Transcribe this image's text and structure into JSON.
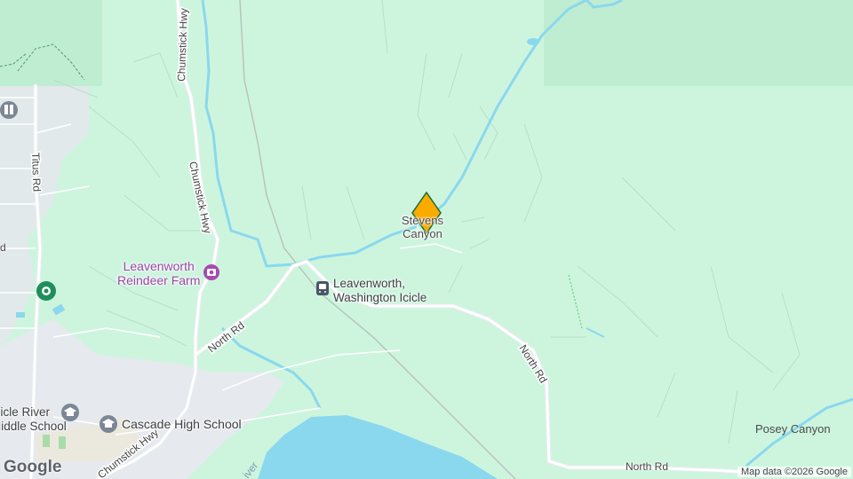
{
  "places": {
    "stevens_canyon": "Stevens\nCanyon",
    "posey_canyon": "Posey Canyon",
    "reindeer_farm": "Leavenworth\nReindeer Farm",
    "station": "Leavenworth,\nWashington Icicle",
    "cascade_high": "Cascade High School",
    "icicle_river_school": "Icicle River\nMiddle School",
    "river_partial": "iver"
  },
  "roads": {
    "chumstick_top": "Chumstick Hwy",
    "chumstick_mid": "Chumstick Hwy",
    "chumstick_bottom": "Chumstick Hwy",
    "titus": "Titus Rd",
    "north_rd_left": "North Rd",
    "north_rd_center": "North Rd",
    "north_rd_bottom": "North Rd",
    "rd_partial": "d"
  },
  "attribution": "Map data ©2026 Google",
  "logo": "Google",
  "colors": {
    "terrain": "#cdf5de",
    "park": "#bfedd2",
    "water": "#8ad8ee",
    "road": "#ffffff",
    "urban": "#e8ebef",
    "marker": "#f9ab00",
    "marker_outline": "#1e6b36"
  }
}
